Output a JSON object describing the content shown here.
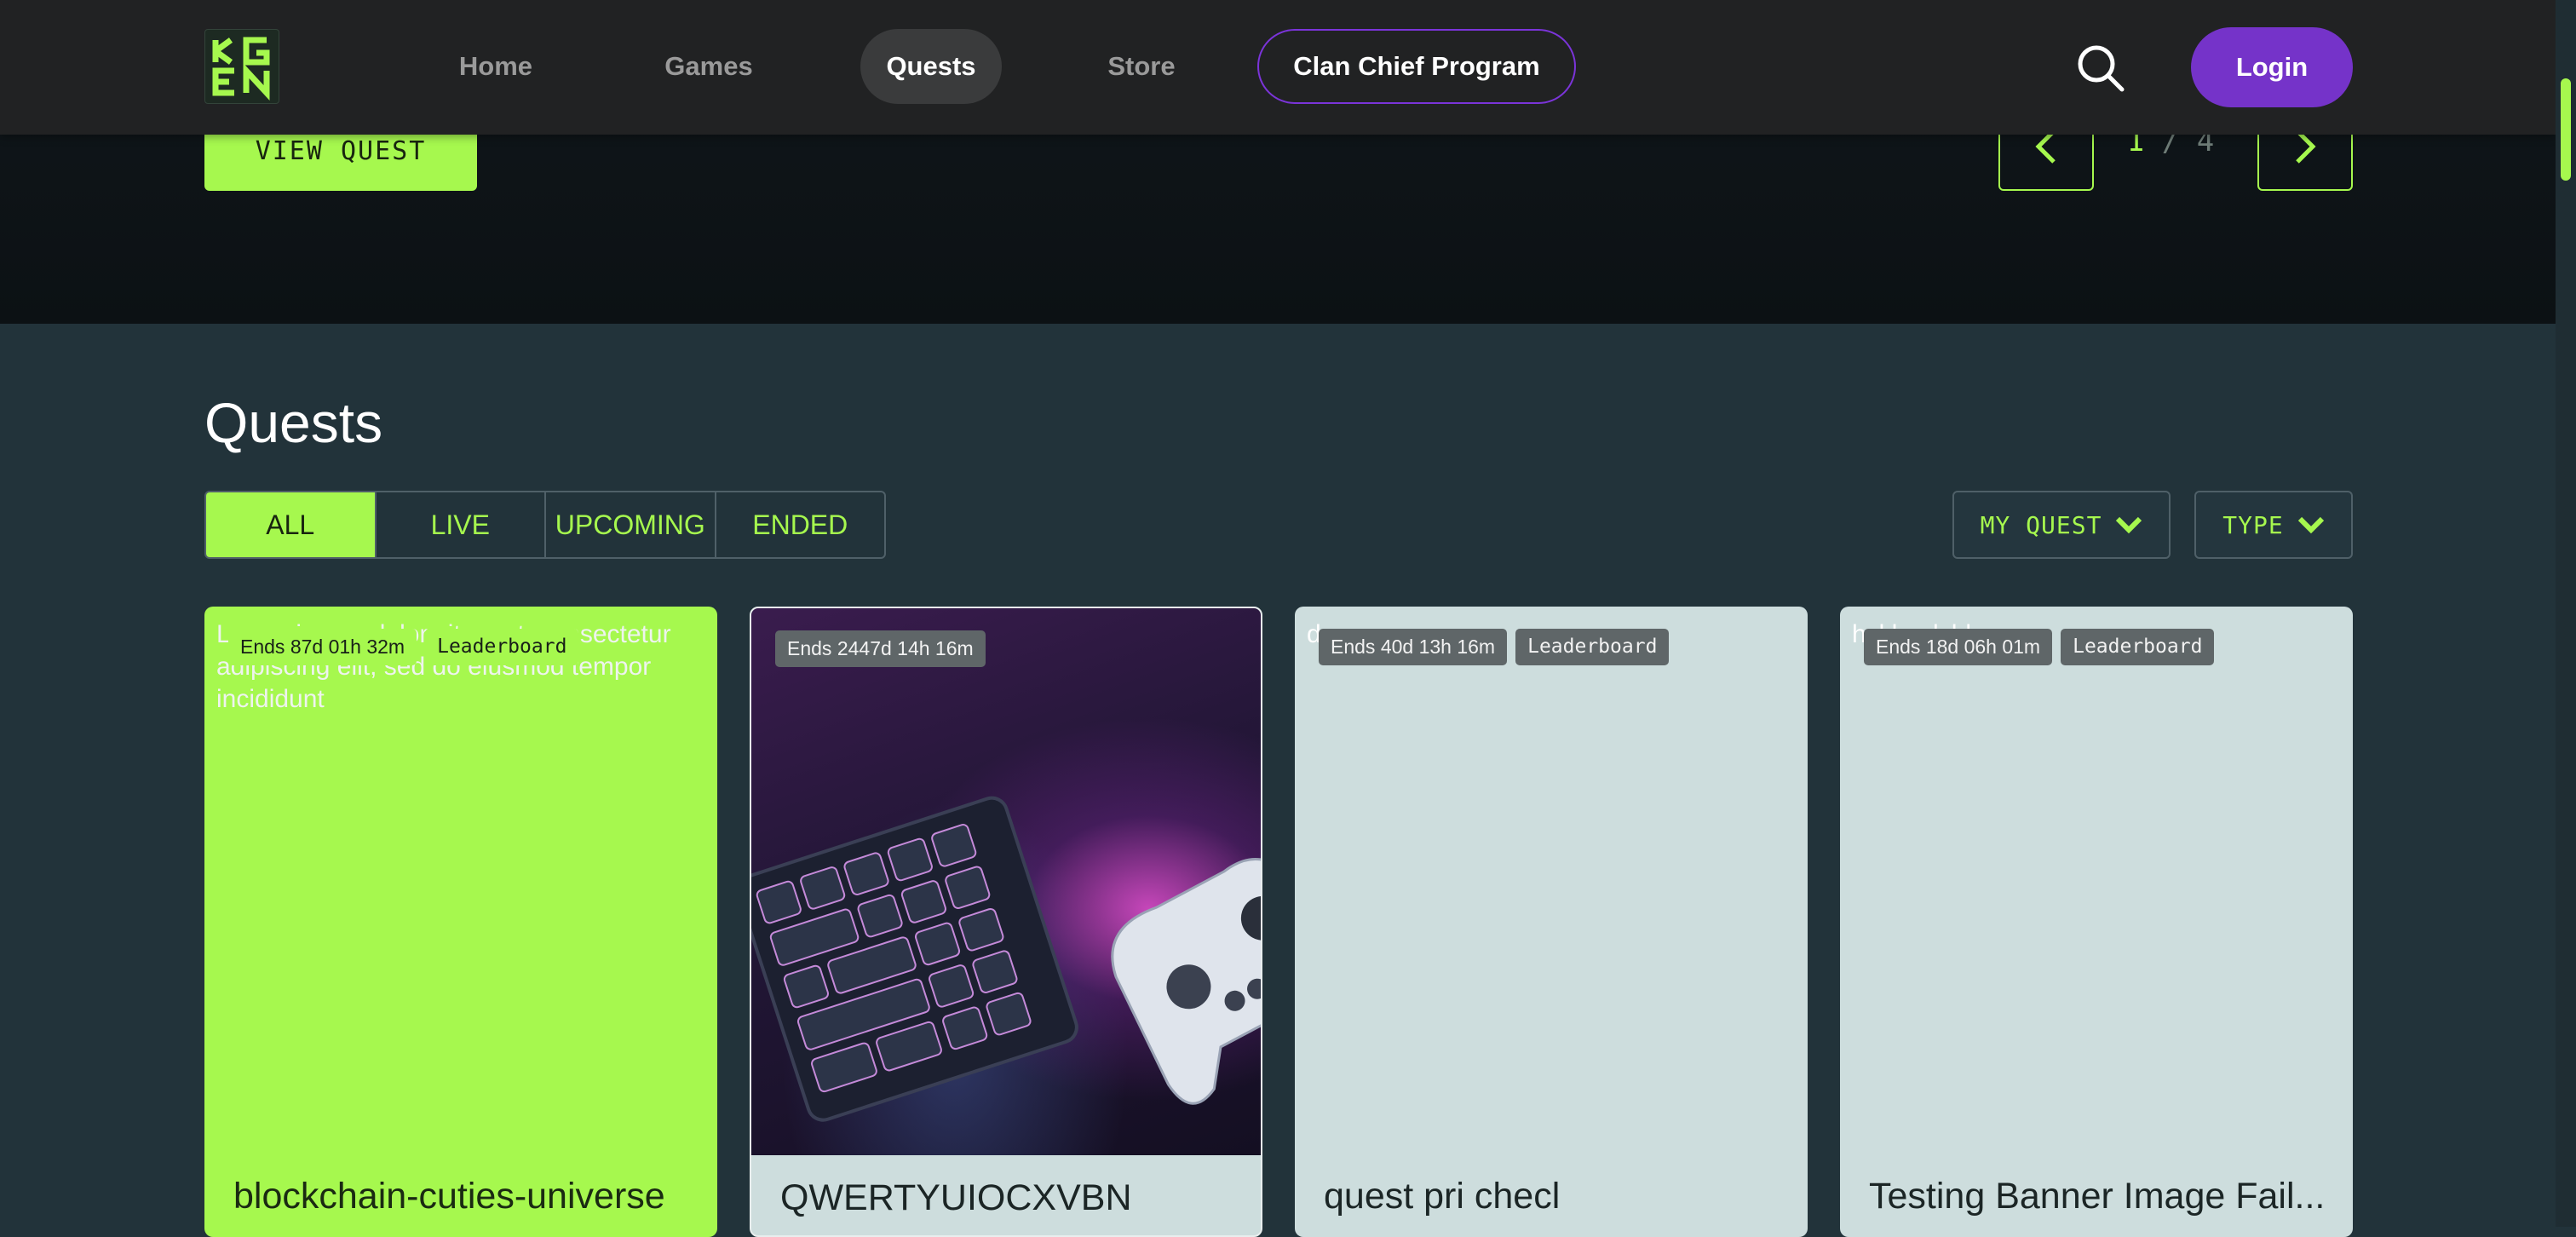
{
  "hero": {
    "view_quest_label": "VIEW QUEST",
    "pager": {
      "current": "1",
      "separator": "/",
      "total": "4"
    }
  },
  "nav": {
    "logo_icon": "kgen-logo",
    "items": [
      {
        "label": "Home"
      },
      {
        "label": "Games"
      },
      {
        "label": "Quests",
        "active": true
      },
      {
        "label": "Store"
      },
      {
        "label": "Clan Chief Program"
      }
    ],
    "search_icon": "search-icon",
    "login_label": "Login"
  },
  "quests": {
    "title": "Quests",
    "tabs": [
      {
        "label": "ALL",
        "active": true
      },
      {
        "label": "LIVE"
      },
      {
        "label": "UPCOMING"
      },
      {
        "label": "ENDED"
      }
    ],
    "filters": [
      {
        "label": "MY QUEST"
      },
      {
        "label": "TYPE"
      }
    ],
    "cards": [
      {
        "image_alt": "Lorem ipsum dolor sit amet, consectetur adipiscing elit, sed do eiusmod tempor incididunt",
        "ends": "Ends 87d 01h 32m",
        "type": "Leaderboard",
        "title": "blockchain-cuties-universe"
      },
      {
        "image_alt": "",
        "ends": "Ends 2447d 14h 16m",
        "type": "",
        "title": "QWERTYUIOCXVBN"
      },
      {
        "image_alt": "desc",
        "ends": "Ends 40d 13h 16m",
        "type": "Leaderboard",
        "title": "quest pri checl"
      },
      {
        "image_alt": "hckhwdchk",
        "ends": "Ends 18d 06h 01m",
        "type": "Leaderboard",
        "title": "Testing Banner Image Fail..."
      }
    ]
  },
  "colors": {
    "accent": "#a6f84e",
    "brand_purple": "#7533c9",
    "background": "#22333a",
    "navbar": "#212223"
  }
}
